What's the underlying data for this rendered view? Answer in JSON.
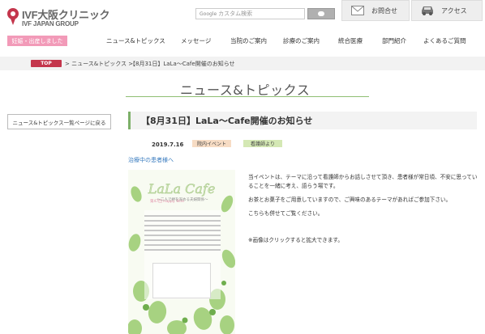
{
  "header": {
    "logo_text": "IVF大阪クリニック",
    "logo_sub": "IVF JAPAN GROUP",
    "search": {
      "label": "Google",
      "placeholder": "カスタム検索"
    },
    "buttons": [
      {
        "label": "お問合せ",
        "icon": "mail-icon"
      },
      {
        "label": "アクセス",
        "icon": "car-icon"
      }
    ],
    "badge": "妊娠・出産しました",
    "nav": [
      "ニュース&トピックス",
      "メッセージ",
      "当院のご案内",
      "診療のご案内",
      "統合医療",
      "部門紹介",
      "よくあるご質問"
    ]
  },
  "breadcrumb": {
    "top": "TOP",
    "items": [
      "> ニュース&トピックス >",
      "【8月31日】LaLa～Cafe開催のお知らせ"
    ]
  },
  "section": {
    "title": "ニュース&トピックス"
  },
  "sidebar": {
    "back_label": "ニュース&トピックス一覧ページに戻る"
  },
  "article": {
    "title": "【8月31日】LaLa～Cafe開催のお知らせ",
    "date": "2019.7.16",
    "tags": [
      "院内イベント",
      "看護師より"
    ],
    "link": "治療中の患者様へ",
    "paragraphs": [
      "当イベントは、テーマに沿って看護師からお話しさせて頂き、患者様が常日頃、不安に思っていることを一緒に考え、語らう場です。",
      "お茶とお菓子をご用意していますので、ご興味のあるテーマがあればご参加下さい。",
      "こちらも併せてご覧ください。",
      "※画像はクリックすると拡大できます。"
    ],
    "poster": {
      "title": "LaLa Cafe",
      "subtitle": "第47回　Happy Wife",
      "note": "～二人で絆を深める夫婦関係～"
    }
  },
  "colors": {
    "accent_green": "#7db069",
    "top_red": "#c4364c",
    "badge_pink": "#f29ab8",
    "link_blue": "#3a7cbf"
  }
}
